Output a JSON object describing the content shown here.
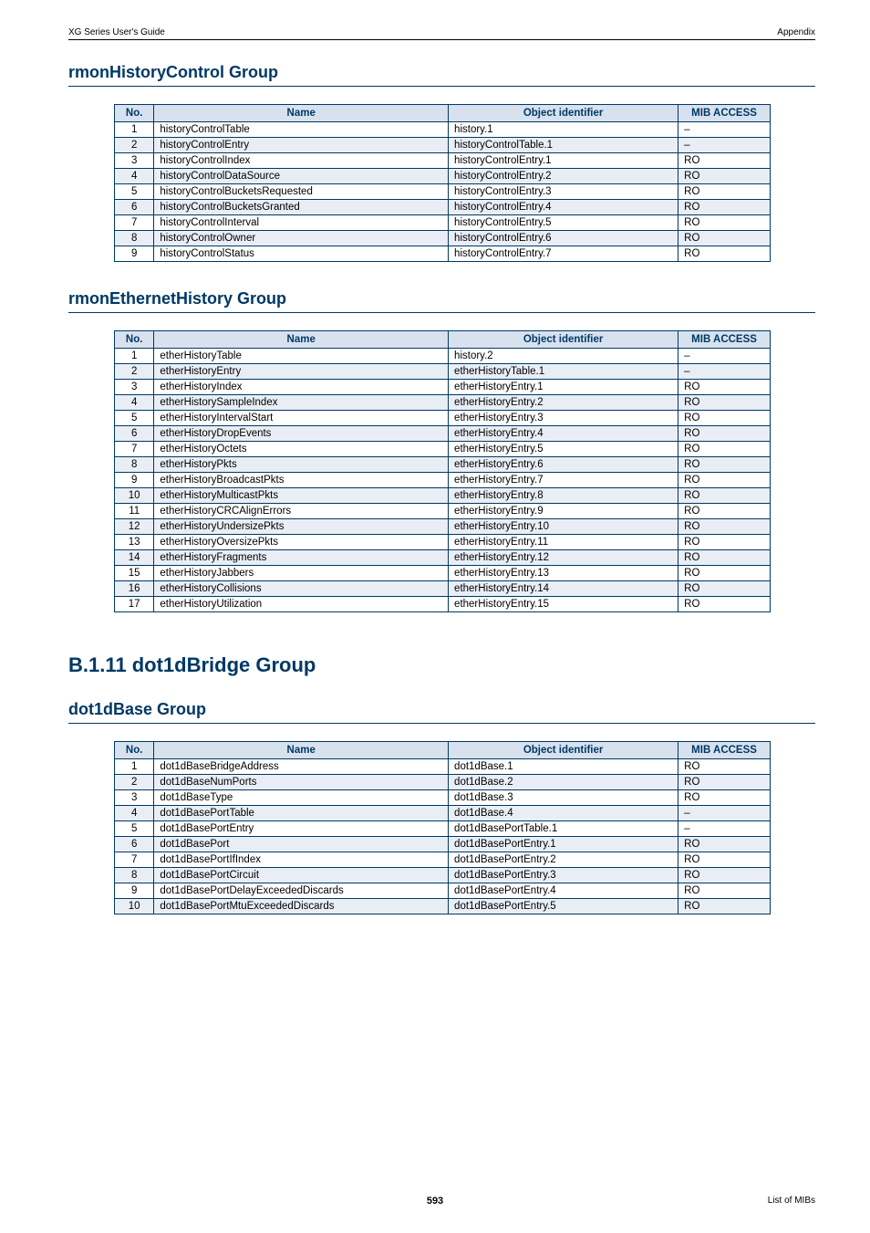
{
  "header": {
    "left": "XG Series User's Guide",
    "right": "Appendix"
  },
  "sections": [
    {
      "heading": "rmonHistoryControl Group",
      "headingClass": "section-heading",
      "table": {
        "headers": [
          "No.",
          "Name",
          "Object identifier",
          "MIB ACCESS"
        ],
        "rows": [
          {
            "no": "1",
            "name": "historyControlTable",
            "obj": "history.1",
            "acc": "–"
          },
          {
            "no": "2",
            "name": "historyControlEntry",
            "obj": "historyControlTable.1",
            "acc": "–"
          },
          {
            "no": "3",
            "name": "historyControlIndex",
            "obj": "historyControlEntry.1",
            "acc": "RO"
          },
          {
            "no": "4",
            "name": "historyControlDataSource",
            "obj": "historyControlEntry.2",
            "acc": "RO"
          },
          {
            "no": "5",
            "name": "historyControlBucketsRequested",
            "obj": "historyControlEntry.3",
            "acc": "RO"
          },
          {
            "no": "6",
            "name": "historyControlBucketsGranted",
            "obj": "historyControlEntry.4",
            "acc": "RO"
          },
          {
            "no": "7",
            "name": "historyControlInterval",
            "obj": "historyControlEntry.5",
            "acc": "RO"
          },
          {
            "no": "8",
            "name": "historyControlOwner",
            "obj": "historyControlEntry.6",
            "acc": "RO"
          },
          {
            "no": "9",
            "name": "historyControlStatus",
            "obj": "historyControlEntry.7",
            "acc": "RO"
          }
        ]
      }
    },
    {
      "heading": "rmonEthernetHistory Group",
      "headingClass": "section-heading",
      "table": {
        "headers": [
          "No.",
          "Name",
          "Object identifier",
          "MIB ACCESS"
        ],
        "rows": [
          {
            "no": "1",
            "name": "etherHistoryTable",
            "obj": "history.2",
            "acc": "–"
          },
          {
            "no": "2",
            "name": "etherHistoryEntry",
            "obj": "etherHistoryTable.1",
            "acc": "–"
          },
          {
            "no": "3",
            "name": "etherHistoryIndex",
            "obj": "etherHistoryEntry.1",
            "acc": "RO"
          },
          {
            "no": "4",
            "name": "etherHistorySampleIndex",
            "obj": "etherHistoryEntry.2",
            "acc": "RO"
          },
          {
            "no": "5",
            "name": "etherHistoryIntervalStart",
            "obj": "etherHistoryEntry.3",
            "acc": "RO"
          },
          {
            "no": "6",
            "name": "etherHistoryDropEvents",
            "obj": "etherHistoryEntry.4",
            "acc": "RO"
          },
          {
            "no": "7",
            "name": "etherHistoryOctets",
            "obj": "etherHistoryEntry.5",
            "acc": "RO"
          },
          {
            "no": "8",
            "name": "etherHistoryPkts",
            "obj": "etherHistoryEntry.6",
            "acc": "RO"
          },
          {
            "no": "9",
            "name": "etherHistoryBroadcastPkts",
            "obj": "etherHistoryEntry.7",
            "acc": "RO"
          },
          {
            "no": "10",
            "name": "etherHistoryMulticastPkts",
            "obj": "etherHistoryEntry.8",
            "acc": "RO"
          },
          {
            "no": "11",
            "name": "etherHistoryCRCAlignErrors",
            "obj": "etherHistoryEntry.9",
            "acc": "RO"
          },
          {
            "no": "12",
            "name": "etherHistoryUndersizePkts",
            "obj": "etherHistoryEntry.10",
            "acc": "RO"
          },
          {
            "no": "13",
            "name": "etherHistoryOversizePkts",
            "obj": "etherHistoryEntry.11",
            "acc": "RO"
          },
          {
            "no": "14",
            "name": "etherHistoryFragments",
            "obj": "etherHistoryEntry.12",
            "acc": "RO"
          },
          {
            "no": "15",
            "name": "etherHistoryJabbers",
            "obj": "etherHistoryEntry.13",
            "acc": "RO"
          },
          {
            "no": "16",
            "name": "etherHistoryCollisions",
            "obj": "etherHistoryEntry.14",
            "acc": "RO"
          },
          {
            "no": "17",
            "name": "etherHistoryUtilization",
            "obj": "etherHistoryEntry.15",
            "acc": "RO"
          }
        ]
      }
    },
    {
      "heading": "B.1.11   dot1dBridge Group",
      "headingClass": "major-heading",
      "table": null
    },
    {
      "heading": "dot1dBase Group",
      "headingClass": "section-heading",
      "table": {
        "headers": [
          "No.",
          "Name",
          "Object identifier",
          "MIB ACCESS"
        ],
        "rows": [
          {
            "no": "1",
            "name": "dot1dBaseBridgeAddress",
            "obj": "dot1dBase.1",
            "acc": "RO"
          },
          {
            "no": "2",
            "name": "dot1dBaseNumPorts",
            "obj": "dot1dBase.2",
            "acc": "RO"
          },
          {
            "no": "3",
            "name": "dot1dBaseType",
            "obj": "dot1dBase.3",
            "acc": "RO"
          },
          {
            "no": "4",
            "name": "dot1dBasePortTable",
            "obj": "dot1dBase.4",
            "acc": "–"
          },
          {
            "no": "5",
            "name": "dot1dBasePortEntry",
            "obj": "dot1dBasePortTable.1",
            "acc": "–"
          },
          {
            "no": "6",
            "name": "dot1dBasePort",
            "obj": "dot1dBasePortEntry.1",
            "acc": "RO"
          },
          {
            "no": "7",
            "name": "dot1dBasePortIfIndex",
            "obj": "dot1dBasePortEntry.2",
            "acc": "RO"
          },
          {
            "no": "8",
            "name": "dot1dBasePortCircuit",
            "obj": "dot1dBasePortEntry.3",
            "acc": "RO"
          },
          {
            "no": "9",
            "name": "dot1dBasePortDelayExceededDiscards",
            "obj": "dot1dBasePortEntry.4",
            "acc": "RO"
          },
          {
            "no": "10",
            "name": "dot1dBasePortMtuExceededDiscards",
            "obj": "dot1dBasePortEntry.5",
            "acc": "RO"
          }
        ]
      }
    }
  ],
  "footer": {
    "page": "593",
    "right": "List of MIBs"
  }
}
